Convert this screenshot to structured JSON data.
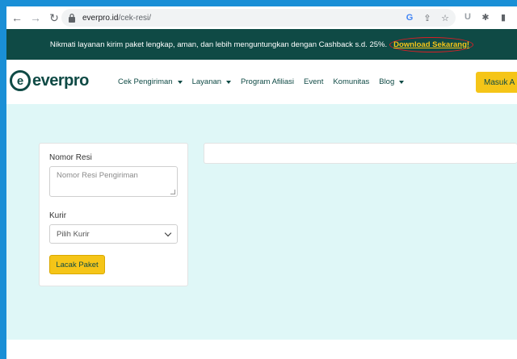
{
  "browser": {
    "url_domain": "everpro.id",
    "url_path": "/cek-resi/"
  },
  "promo": {
    "text": "Nikmati layanan kirim paket lengkap, aman, dan lebih menguntungkan dengan Cashback s.d. 25%.",
    "link_label": "Download Sekarang!"
  },
  "header": {
    "logo_text": "everpro",
    "logo_mark": "e",
    "nav": [
      {
        "label": "Cek Pengiriman",
        "dropdown": true
      },
      {
        "label": "Layanan",
        "dropdown": true
      },
      {
        "label": "Program Afiliasi",
        "dropdown": false
      },
      {
        "label": "Event",
        "dropdown": false
      },
      {
        "label": "Komunitas",
        "dropdown": false
      },
      {
        "label": "Blog",
        "dropdown": true
      }
    ],
    "login_label": "Masuk A"
  },
  "form": {
    "resi_label": "Nomor Resi",
    "resi_placeholder": "Nomor Resi Pengiriman",
    "kurir_label": "Kurir",
    "kurir_selected": "Pilih Kurir",
    "submit_label": "Lacak Paket"
  },
  "colors": {
    "brand_dark": "#0f4a45",
    "accent_yellow": "#f5c518",
    "highlight_circle": "#d81f26",
    "content_bg": "#dff7f7"
  },
  "icons": {
    "back": "back-arrow-icon",
    "forward": "forward-arrow-icon",
    "reload": "reload-icon",
    "lock": "lock-icon",
    "google": "google-icon",
    "share": "share-icon",
    "star": "star-icon",
    "ublock": "extension-u-icon",
    "puzzle": "extensions-puzzle-icon",
    "sidebar": "sidebar-icon"
  }
}
